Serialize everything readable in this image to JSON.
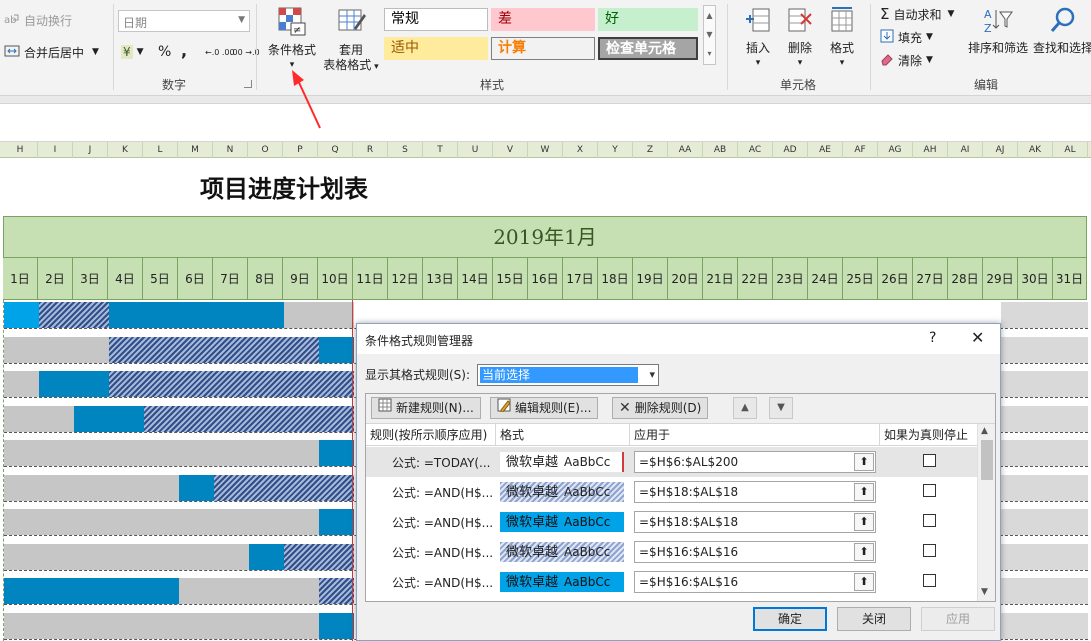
{
  "ribbon": {
    "alignment": {
      "wrap_text": "自动换行",
      "merge_center": "合并后居中"
    },
    "number": {
      "format_value": "日期",
      "currency": "¥",
      "percent": "%",
      "comma": ",",
      "inc_decimal": "←.0 .00",
      "dec_decimal": ".00 →.0",
      "group_label": "数字"
    },
    "styles": {
      "conditional_format": "条件格式",
      "table_format_line1": "套用",
      "table_format_line2": "表格格式",
      "cell_styles": [
        {
          "label": "常规",
          "bg": "#ffffff",
          "color": "#000000",
          "border": "#bcbcbc"
        },
        {
          "label": "差",
          "bg": "#ffc7ce",
          "color": "#9c0006",
          "border": "#ffc7ce"
        },
        {
          "label": "好",
          "bg": "#c6efce",
          "color": "#006100",
          "border": "#c6efce"
        },
        {
          "label": "适中",
          "bg": "#ffeb9c",
          "color": "#9c5700",
          "border": "#ffeb9c"
        },
        {
          "label": "计算",
          "bg": "#f2f2f2",
          "color": "#fa7d00",
          "border": "#7f7f7f"
        },
        {
          "label": "检查单元格",
          "bg": "#a5a5a5",
          "color": "#ffffff",
          "border": "#3f3f3f"
        }
      ],
      "group_label": "样式"
    },
    "cells": {
      "insert": "插入",
      "delete": "删除",
      "format": "格式",
      "group_label": "单元格"
    },
    "editing": {
      "autosum": "自动求和",
      "fill": "填充",
      "clear": "清除",
      "sort_filter": "排序和筛选",
      "find_select": "查找和选择",
      "group_label": "编辑"
    }
  },
  "columns": [
    "H",
    "I",
    "J",
    "K",
    "L",
    "M",
    "N",
    "O",
    "P",
    "Q",
    "R",
    "S",
    "T",
    "U",
    "V",
    "W",
    "X",
    "Y",
    "Z",
    "AA",
    "AB",
    "AC",
    "AD",
    "AE",
    "AF",
    "AG",
    "AH",
    "AI",
    "AJ",
    "AK",
    "AL"
  ],
  "sheet": {
    "title": "项目进度计划表",
    "month": "2019年1月",
    "days": [
      "1日",
      "2日",
      "3日",
      "4日",
      "5日",
      "6日",
      "7日",
      "8日",
      "9日",
      "10日",
      "11日",
      "12日",
      "13日",
      "14日",
      "15日",
      "16日",
      "17日",
      "18日",
      "19日",
      "20日",
      "21日",
      "22日",
      "23日",
      "24日",
      "25日",
      "26日",
      "27日",
      "28日",
      "29日",
      "30日",
      "31日"
    ]
  },
  "dialog": {
    "title": "条件格式规则管理器",
    "help": "?",
    "close": "✕",
    "show_label": "显示其格式规则(S):",
    "show_value": "当前选择",
    "new_rule": "新建规则(N)...",
    "edit_rule": "编辑规则(E)...",
    "delete_rule": "删除规则(D)",
    "columns": {
      "rule": "规则(按所示顺序应用)",
      "format": "格式",
      "applies_to": "应用于",
      "stop_if_true": "如果为真则停止"
    },
    "rules": [
      {
        "rule": "公式: =TODAY(...",
        "preview": "微软卓越",
        "abc": "AaBbCc",
        "style": "today",
        "applies": "=$H$6:$AL$200"
      },
      {
        "rule": "公式: =AND(H$...",
        "preview": "微软卓越",
        "abc": "AaBbCc",
        "style": "hatch",
        "applies": "=$H$18:$AL$18"
      },
      {
        "rule": "公式: =AND(H$...",
        "preview": "微软卓越",
        "abc": "AaBbCc",
        "style": "blue",
        "applies": "=$H$18:$AL$18"
      },
      {
        "rule": "公式: =AND(H$...",
        "preview": "微软卓越",
        "abc": "AaBbCc",
        "style": "hatch",
        "applies": "=$H$16:$AL$16"
      },
      {
        "rule": "公式: =AND(H$...",
        "preview": "微软卓越",
        "abc": "AaBbCc",
        "style": "blue",
        "applies": "=$H$16:$AL$16"
      }
    ],
    "ok": "确定",
    "close_btn": "关闭",
    "apply": "应用"
  }
}
